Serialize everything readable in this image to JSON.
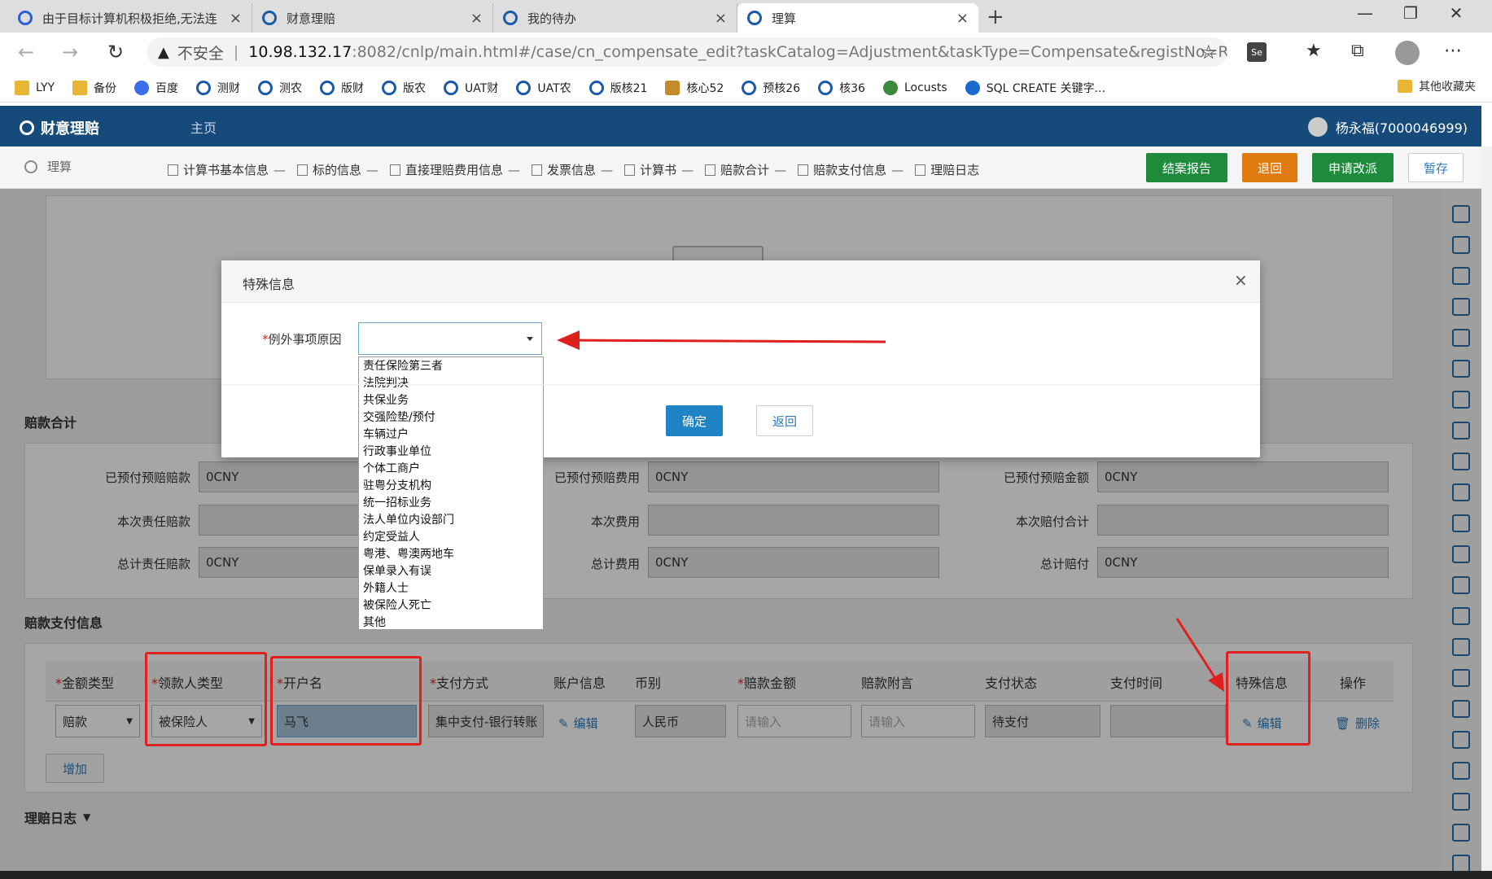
{
  "browser": {
    "tabs": [
      {
        "label": "由于目标计算机积极拒绝,无法连",
        "close": "×"
      },
      {
        "label": "财意理赔",
        "close": "×"
      },
      {
        "label": "我的待办",
        "close": "×"
      },
      {
        "label": "理算",
        "close": "×"
      }
    ],
    "new_tab": "+",
    "window_controls": [
      "—",
      "❐",
      "✕"
    ],
    "nav": [
      "←",
      "→",
      "↻"
    ],
    "insecure_label": "不安全",
    "separator": "|",
    "url_host": "10.98.132.17",
    "url_path": ":8082/cnlp/main.html#/case/cn_compensate_edit?taskCatalog=Adjustment&taskType=Compensate&registNo=RZ...",
    "star": "☆",
    "selenium_icon": "Se",
    "toolbar_icons": [
      "★",
      "⧉",
      "⋯"
    ],
    "bookmarks": [
      {
        "label": "LYY",
        "icon": "folder"
      },
      {
        "label": "备份",
        "icon": "folder"
      },
      {
        "label": "百度",
        "icon": "paw"
      },
      {
        "label": "测财",
        "icon": "swirl"
      },
      {
        "label": "测农",
        "icon": "swirl"
      },
      {
        "label": "版财",
        "icon": "swirl"
      },
      {
        "label": "版农",
        "icon": "swirl"
      },
      {
        "label": "UAT财",
        "icon": "swirl"
      },
      {
        "label": "UAT农",
        "icon": "swirl"
      },
      {
        "label": "版核21",
        "icon": "swirl"
      },
      {
        "label": "核心52",
        "icon": "horse"
      },
      {
        "label": "预核26",
        "icon": "swirl"
      },
      {
        "label": "核36",
        "icon": "swirl"
      },
      {
        "label": "Locusts",
        "icon": "green"
      },
      {
        "label": "SQL CREATE 关键字...",
        "icon": "blue"
      }
    ],
    "other_bookmarks": "其他收藏夹"
  },
  "app": {
    "brand": "财意理赔",
    "home": "主页",
    "user": "杨永福(7000046999)"
  },
  "toolbar": {
    "breadcrumb": "理算",
    "steps": [
      "计算书基本信息",
      "标的信息",
      "直接理赔费用信息",
      "发票信息",
      "计算书",
      "赔款合计",
      "赔款支付信息",
      "理赔日志"
    ],
    "step_sep": "—",
    "buttons": [
      {
        "label": "结案报告",
        "color": "#1e8a3c"
      },
      {
        "label": "退回",
        "color": "#e07b12"
      },
      {
        "label": "申请改派",
        "color": "#1e8a3c"
      },
      {
        "label": "暂存",
        "color": "#ffffff"
      }
    ]
  },
  "summary": {
    "title": "赔款合计",
    "fields": [
      {
        "label": "已预付预赔赔款",
        "value": "0CNY"
      },
      {
        "label": "已预付预赔费用",
        "value": "0CNY"
      },
      {
        "label": "已预付预赔金额",
        "value": "0CNY"
      },
      {
        "label": "本次责任赔款",
        "value": ""
      },
      {
        "label": "本次费用",
        "value": ""
      },
      {
        "label": "本次赔付合计",
        "value": ""
      },
      {
        "label": "总计责任赔款",
        "value": "0CNY"
      },
      {
        "label": "总计费用",
        "value": "0CNY"
      },
      {
        "label": "总计赔付",
        "value": "0CNY"
      }
    ]
  },
  "payment": {
    "title": "赔款支付信息",
    "required_mark": "*",
    "headers": [
      "金额类型",
      "领款人类型",
      "开户名",
      "支付方式",
      "账户信息",
      "币别",
      "赔款金额",
      "赔款附言",
      "支付状态",
      "支付时间",
      "特殊信息",
      "操作"
    ],
    "row": {
      "amount_type": "赔款",
      "payee_type": "被保险人",
      "account_name": "马飞",
      "pay_method": "集中支付-银行转账",
      "account_info_link": "编辑",
      "currency": "人民币",
      "amount_placeholder": "请输入",
      "remark_placeholder": "请输入",
      "status": "待支付",
      "time": "",
      "special_link": "编辑",
      "delete_link": "删除"
    },
    "add_button": "增加"
  },
  "log": {
    "title": "理赔日志",
    "caret": "▼"
  },
  "modal": {
    "title": "特殊信息",
    "close": "×",
    "field_label": "例外事项原因",
    "required_mark": "*",
    "selected": "",
    "options": [
      "责任保险第三者",
      "法院判决",
      "共保业务",
      "交强险垫/预付",
      "车辆过户",
      "行政事业单位",
      "个体工商户",
      "驻粤分支机构",
      "统一招标业务",
      "法人单位内设部门",
      "约定受益人",
      "粤港、粤澳两地车",
      "保单录入有误",
      "外籍人士",
      "被保险人死亡",
      "其他"
    ],
    "ok": "确定",
    "back": "返回"
  },
  "annotation_color": "#e0201e"
}
